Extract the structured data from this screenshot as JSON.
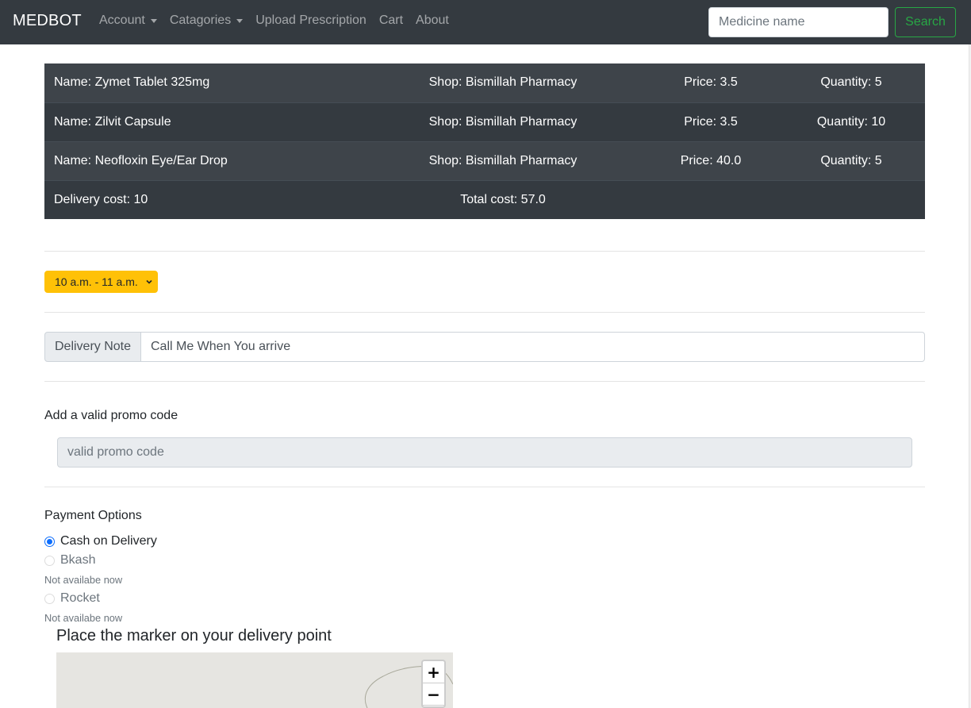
{
  "navbar": {
    "brand": "MEDBOT",
    "links": [
      {
        "label": "Account",
        "dropdown": true
      },
      {
        "label": "Catagories",
        "dropdown": true
      },
      {
        "label": "Upload Prescription",
        "dropdown": false
      },
      {
        "label": "Cart",
        "dropdown": false
      },
      {
        "label": "About",
        "dropdown": false
      }
    ],
    "search_placeholder": "Medicine name",
    "search_button": "Search"
  },
  "cart": {
    "items": [
      {
        "name": "Name: Zymet Tablet 325mg",
        "shop": "Shop: Bismillah Pharmacy",
        "price": "Price: 3.5",
        "quantity": "Quantity: 5"
      },
      {
        "name": "Name: Zilvit Capsule",
        "shop": "Shop: Bismillah Pharmacy",
        "price": "Price: 3.5",
        "quantity": "Quantity: 10"
      },
      {
        "name": "Name: Neofloxin Eye/Ear Drop",
        "shop": "Shop: Bismillah Pharmacy",
        "price": "Price: 40.0",
        "quantity": "Quantity: 5"
      }
    ],
    "delivery_cost": "Delivery cost: 10",
    "total_cost": "Total cost: 57.0"
  },
  "delivery_time": {
    "selected": "10 a.m. - 11 a.m."
  },
  "delivery_note": {
    "label": "Delivery Note",
    "value": "Call Me When You arrive"
  },
  "promo": {
    "title": "Add a valid promo code",
    "placeholder": "valid promo code"
  },
  "payment": {
    "title": "Payment Options",
    "options": [
      {
        "label": "Cash on Delivery",
        "checked": true,
        "note": ""
      },
      {
        "label": "Bkash",
        "checked": false,
        "note": "Not availabe now"
      },
      {
        "label": "Rocket",
        "checked": false,
        "note": "Not availabe now"
      }
    ]
  },
  "map": {
    "title": "Place the marker on your delivery point",
    "zoom_in": "+",
    "zoom_out": "−"
  },
  "colors": {
    "navbar": "#343a40",
    "accent_select": "#ffc107",
    "search_button": "#28a745",
    "radio_checked": "#0d6efd"
  }
}
